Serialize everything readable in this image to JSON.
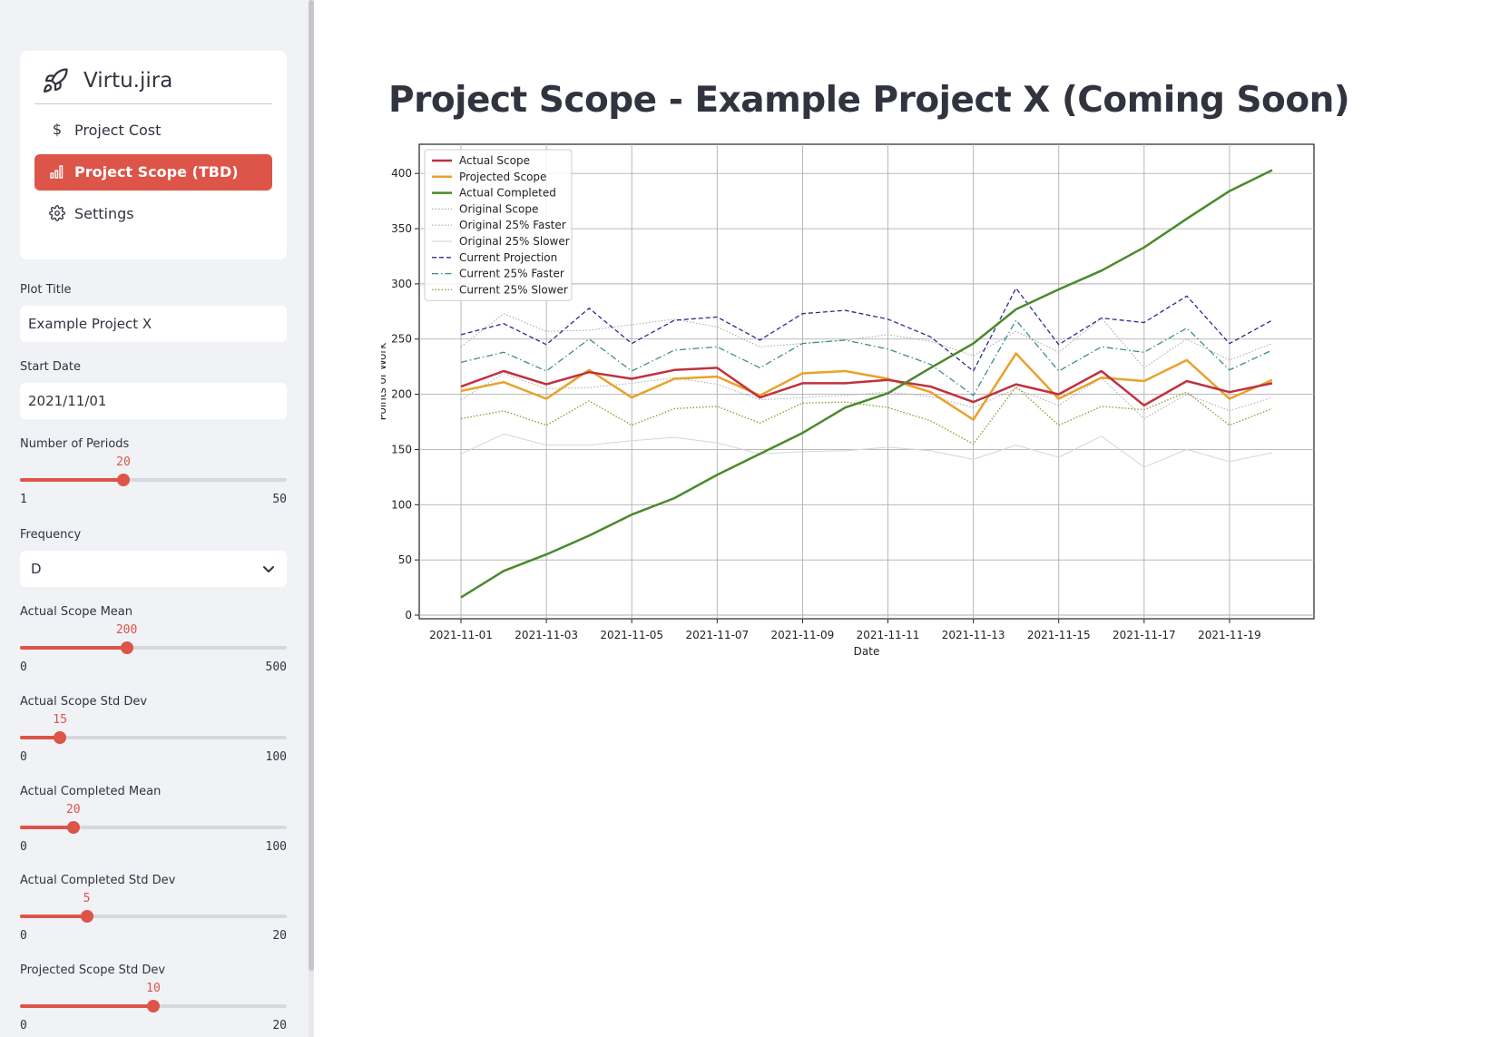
{
  "sidebar": {
    "app_name": "Virtu.jira",
    "nav": [
      {
        "label": "Project Cost",
        "icon": "dollar-icon",
        "glyph": "$"
      },
      {
        "label": "Project Scope (TBD)",
        "icon": "bar-chart-icon",
        "active": true
      },
      {
        "label": "Settings",
        "icon": "gear-icon"
      }
    ],
    "plot_title": {
      "label": "Plot Title",
      "value": "Example Project X"
    },
    "start_date": {
      "label": "Start Date",
      "value": "2021/11/01"
    },
    "frequency": {
      "label": "Frequency",
      "value": "D"
    },
    "sliders": [
      {
        "label": "Number of Periods",
        "value": 20,
        "min": 1,
        "max": 50
      },
      {
        "label": "Actual Scope Mean",
        "value": 200,
        "min": 0,
        "max": 500
      },
      {
        "label": "Actual Scope Std Dev",
        "value": 15,
        "min": 0,
        "max": 100
      },
      {
        "label": "Actual Completed Mean",
        "value": 20,
        "min": 0,
        "max": 100
      },
      {
        "label": "Actual Completed Std Dev",
        "value": 5,
        "min": 0,
        "max": 20
      },
      {
        "label": "Projected Scope Std Dev",
        "value": 10,
        "min": 0,
        "max": 20
      }
    ]
  },
  "main": {
    "title": "Project Scope - Example Project X (Coming Soon)"
  },
  "colors": {
    "accent": "#dd5448",
    "sidebar_bg": "#f0f2f6"
  },
  "chart_data": {
    "type": "line",
    "xlabel": "Date",
    "ylabel": "Points of Work",
    "ylim": [
      0,
      410
    ],
    "yticks": [
      0,
      50,
      100,
      150,
      200,
      250,
      300,
      350,
      400
    ],
    "grid": true,
    "legend_position": "top-left",
    "x": [
      "2021-11-01",
      "2021-11-02",
      "2021-11-03",
      "2021-11-04",
      "2021-11-05",
      "2021-11-06",
      "2021-11-07",
      "2021-11-08",
      "2021-11-09",
      "2021-11-10",
      "2021-11-11",
      "2021-11-12",
      "2021-11-13",
      "2021-11-14",
      "2021-11-15",
      "2021-11-16",
      "2021-11-17",
      "2021-11-18",
      "2021-11-19",
      "2021-11-20"
    ],
    "xticks": [
      "2021-11-01",
      "2021-11-03",
      "2021-11-05",
      "2021-11-07",
      "2021-11-09",
      "2021-11-11",
      "2021-11-13",
      "2021-11-15",
      "2021-11-17",
      "2021-11-19"
    ],
    "series": [
      {
        "name": "Actual Scope",
        "color": "#c0313d",
        "style": "solid",
        "width": 2.5,
        "values": [
          207,
          221,
          209,
          220,
          214,
          222,
          224,
          197,
          210,
          210,
          213,
          207,
          193,
          209,
          200,
          221,
          190,
          212,
          202,
          210
        ]
      },
      {
        "name": "Projected Scope",
        "color": "#e8a22b",
        "style": "solid",
        "width": 2.5,
        "values": [
          203,
          211,
          196,
          222,
          197,
          214,
          216,
          199,
          219,
          221,
          214,
          202,
          177,
          237,
          196,
          215,
          212,
          231,
          196,
          213
        ]
      },
      {
        "name": "Actual Completed",
        "color": "#4a8a2c",
        "style": "solid",
        "width": 2.5,
        "values": [
          16,
          40,
          55,
          72,
          91,
          106,
          127,
          146,
          165,
          188,
          201,
          224,
          246,
          277,
          295,
          312,
          333,
          359,
          384,
          403
        ]
      },
      {
        "name": "Original Scope",
        "color": "#a9a9b3",
        "style": "dotted",
        "width": 1,
        "values": [
          195,
          219,
          205,
          206,
          210,
          215,
          209,
          195,
          197,
          199,
          202,
          198,
          188,
          205,
          190,
          215,
          178,
          200,
          185,
          197
        ]
      },
      {
        "name": "Original 25% Faster",
        "color": "#a5a5ae",
        "style": "dotted",
        "width": 1,
        "values": [
          243,
          273,
          257,
          258,
          263,
          268,
          261,
          243,
          246,
          249,
          254,
          248,
          235,
          257,
          238,
          269,
          224,
          250,
          231,
          246
        ]
      },
      {
        "name": "Original 25% Slower",
        "color": "#d6d6da",
        "style": "solid",
        "width": 1,
        "values": [
          146,
          164,
          154,
          154,
          158,
          161,
          156,
          146,
          148,
          149,
          152,
          149,
          141,
          154,
          143,
          162,
          134,
          150,
          139,
          147
        ]
      },
      {
        "name": "Current Projection",
        "color": "#2b2b8c",
        "style": "dashed",
        "width": 1.3,
        "values": [
          254,
          264,
          245,
          278,
          246,
          267,
          270,
          249,
          273,
          276,
          268,
          252,
          221,
          296,
          245,
          269,
          265,
          289,
          246,
          267
        ]
      },
      {
        "name": "Current 25% Faster",
        "color": "#3d8c8c",
        "style": "dashdot",
        "width": 1.3,
        "values": [
          229,
          238,
          221,
          250,
          221,
          240,
          243,
          224,
          246,
          249,
          241,
          227,
          199,
          267,
          221,
          243,
          238,
          260,
          222,
          240
        ]
      },
      {
        "name": "Current 25% Slower",
        "color": "#8a9a2a",
        "style": "dotted",
        "width": 1.3,
        "values": [
          178,
          185,
          172,
          194,
          172,
          187,
          189,
          174,
          192,
          193,
          188,
          176,
          155,
          207,
          172,
          189,
          186,
          202,
          172,
          187
        ]
      }
    ]
  }
}
